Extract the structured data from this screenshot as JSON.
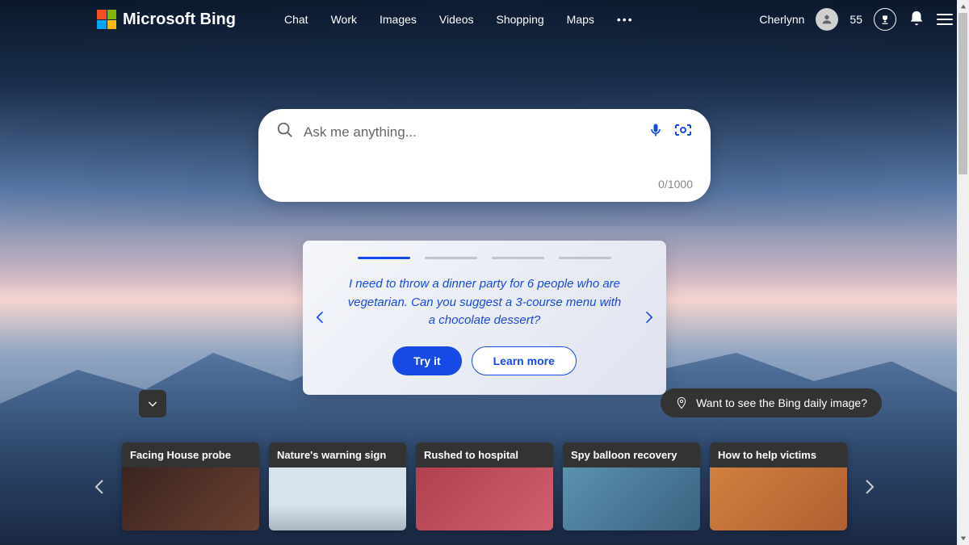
{
  "brand": "Microsoft Bing",
  "nav": [
    "Chat",
    "Work",
    "Images",
    "Videos",
    "Shopping",
    "Maps"
  ],
  "user": {
    "name": "Cherlynn",
    "points": "55"
  },
  "search": {
    "placeholder": "Ask me anything...",
    "char_count": "0/1000"
  },
  "suggestion": {
    "active_index": 0,
    "text": "I need to throw a dinner party for 6 people who are vegetarian. Can you suggest a 3-course menu with a chocolate dessert?",
    "try_label": "Try it",
    "learn_label": "Learn more"
  },
  "daily_image_prompt": "Want to see the Bing daily image?",
  "news": [
    {
      "title": "Facing House probe"
    },
    {
      "title": "Nature's warning sign"
    },
    {
      "title": "Rushed to hospital"
    },
    {
      "title": "Spy balloon recovery"
    },
    {
      "title": "How to help victims"
    }
  ]
}
